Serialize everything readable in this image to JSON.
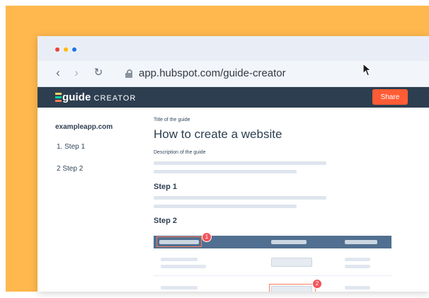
{
  "browser": {
    "url": "app.hubspot.com/guide-creator"
  },
  "app": {
    "logo_main": "guide",
    "logo_sub": "CREATOR",
    "share_label": "Share"
  },
  "sidebar": {
    "site": "exampleapp.com",
    "steps": [
      "1.  Step 1",
      "2  Step 2"
    ]
  },
  "guide": {
    "title_label": "Title of the guide",
    "title": "How to create a website",
    "description_label": "Description of the guide",
    "step1_heading": "Step 1",
    "step2_heading": "Step 2"
  },
  "screenshot": {
    "badges": [
      "1",
      "2"
    ]
  },
  "colors": {
    "background": "#ffb84d",
    "app_bar": "#2d3e50",
    "share": "#ff5c35",
    "highlight": "#ff7a59",
    "badge": "#f2545b"
  },
  "icons": [
    "back-arrow-icon",
    "forward-arrow-icon",
    "reload-icon",
    "lock-icon",
    "guide-logo-icon",
    "mouse-cursor-icon"
  ]
}
